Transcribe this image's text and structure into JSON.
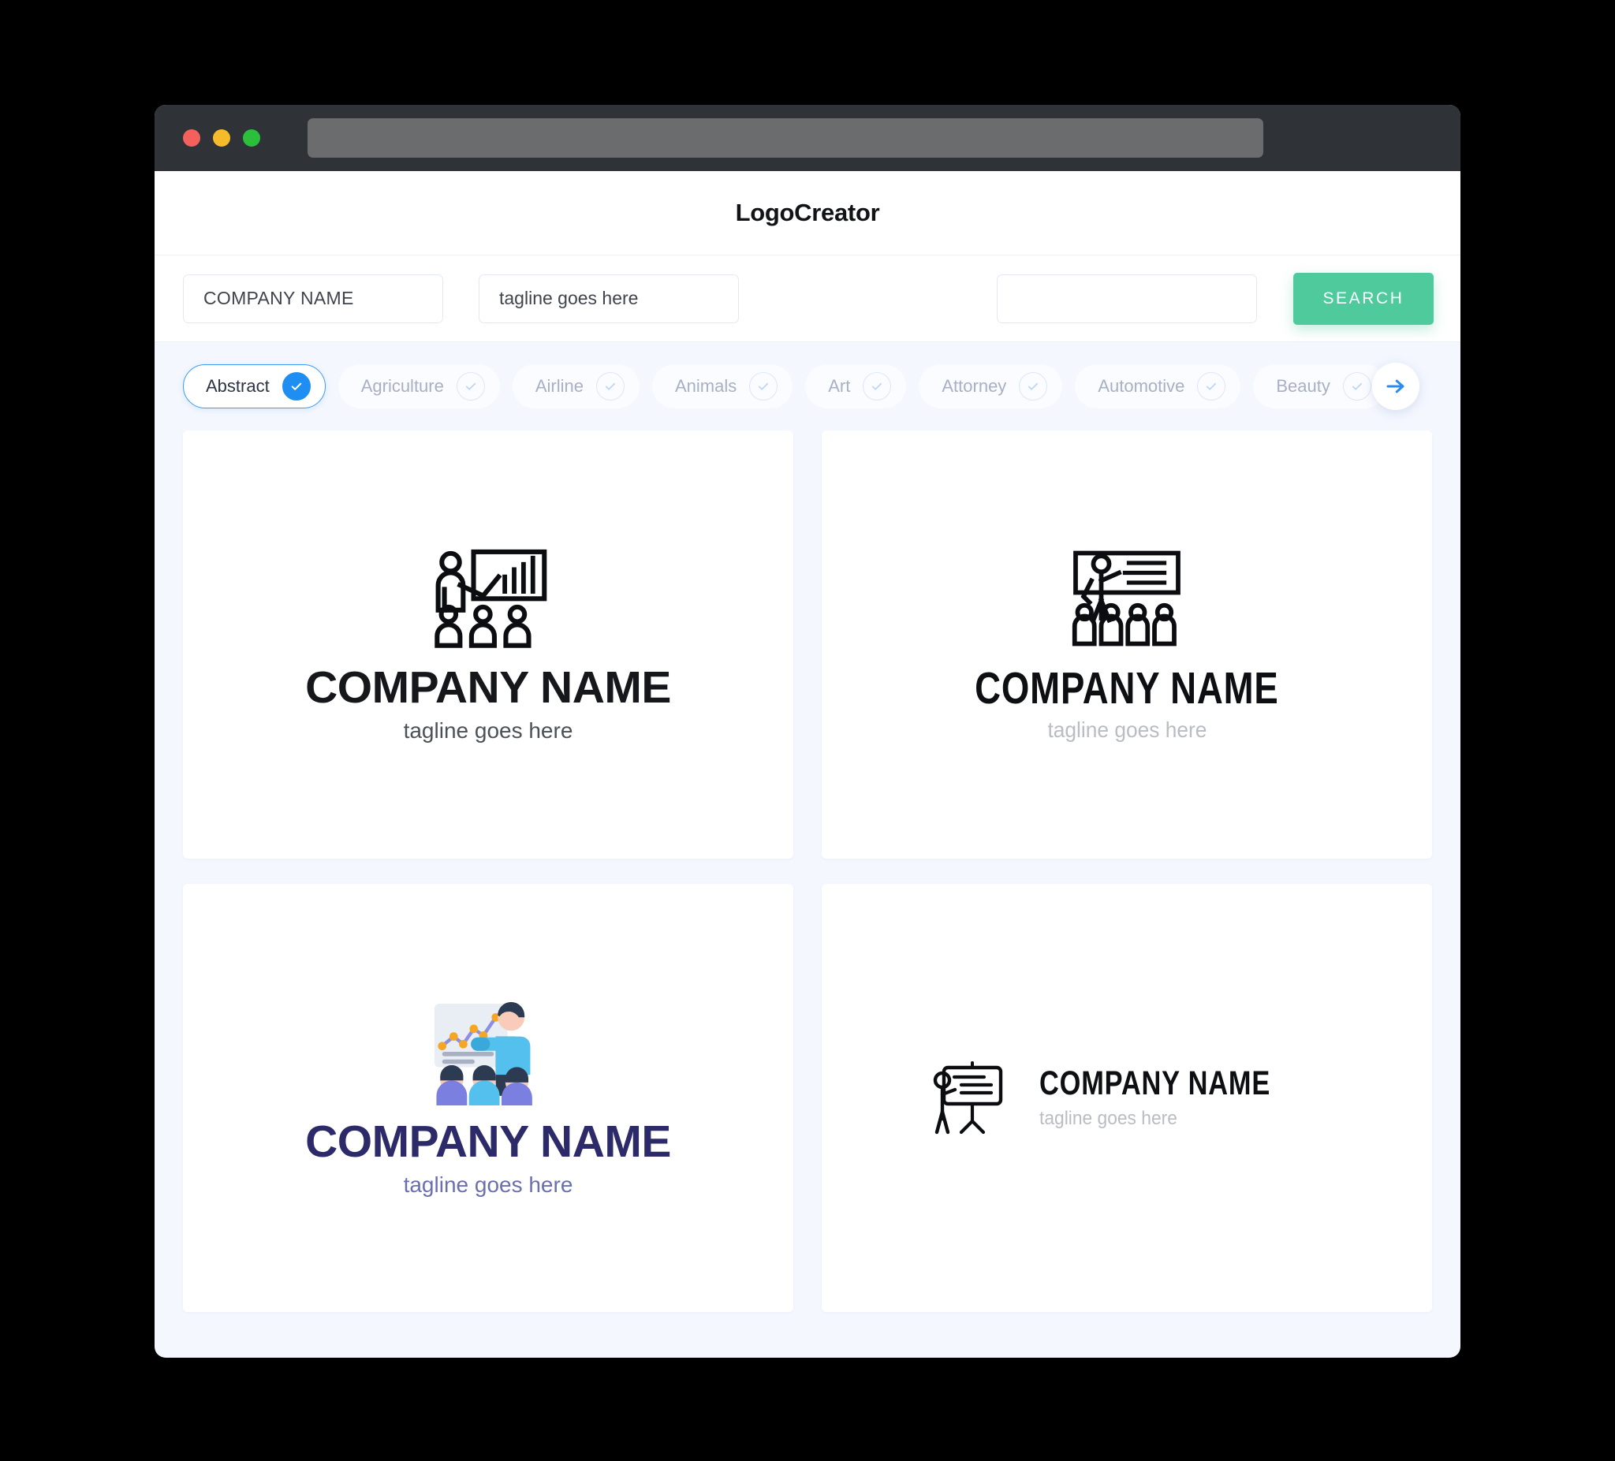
{
  "window": {
    "traffic_lights": [
      "close-red",
      "minimize-yellow",
      "maximize-green"
    ],
    "address_bar_value": ""
  },
  "header": {
    "title": "LogoCreator"
  },
  "search": {
    "company_value": "COMPANY NAME",
    "tagline_value": "tagline goes here",
    "extra_value": "",
    "extra_placeholder": "",
    "search_label": "SEARCH"
  },
  "categories": {
    "next_icon": "arrow-right-icon",
    "items": [
      {
        "label": "Abstract",
        "selected": true
      },
      {
        "label": "Agriculture",
        "selected": false
      },
      {
        "label": "Airline",
        "selected": false
      },
      {
        "label": "Animals",
        "selected": false
      },
      {
        "label": "Art",
        "selected": false
      },
      {
        "label": "Attorney",
        "selected": false
      },
      {
        "label": "Automotive",
        "selected": false
      },
      {
        "label": "Beauty",
        "selected": false
      }
    ]
  },
  "results": {
    "cards": [
      {
        "icon": "presenter-whiteboard-barchart-audience-icon",
        "name": "COMPANY NAME",
        "tagline": "tagline goes here",
        "name_color": "#15171a",
        "tagline_color": "#4c5157"
      },
      {
        "icon": "presenter-board-lines-audience-icon",
        "name": "COMPANY NAME",
        "tagline": "tagline goes here",
        "name_color": "#0d0f12",
        "tagline_color": "#b9bdc3"
      },
      {
        "icon": "presentation-linechart-team-color-icon",
        "name": "COMPANY NAME",
        "tagline": "tagline goes here",
        "name_color": "#2c2a68",
        "tagline_color": "#6a6fae"
      },
      {
        "icon": "presenter-flipchart-easel-icon",
        "name": "COMPANY NAME",
        "tagline": "tagline goes here",
        "name_color": "#0d0f12",
        "tagline_color": "#b9bdc3"
      }
    ]
  },
  "colors": {
    "accent_green": "#4fca9d",
    "accent_blue": "#1e8ef3",
    "page_bg": "#f4f7fe",
    "chrome": "#2f3236"
  }
}
